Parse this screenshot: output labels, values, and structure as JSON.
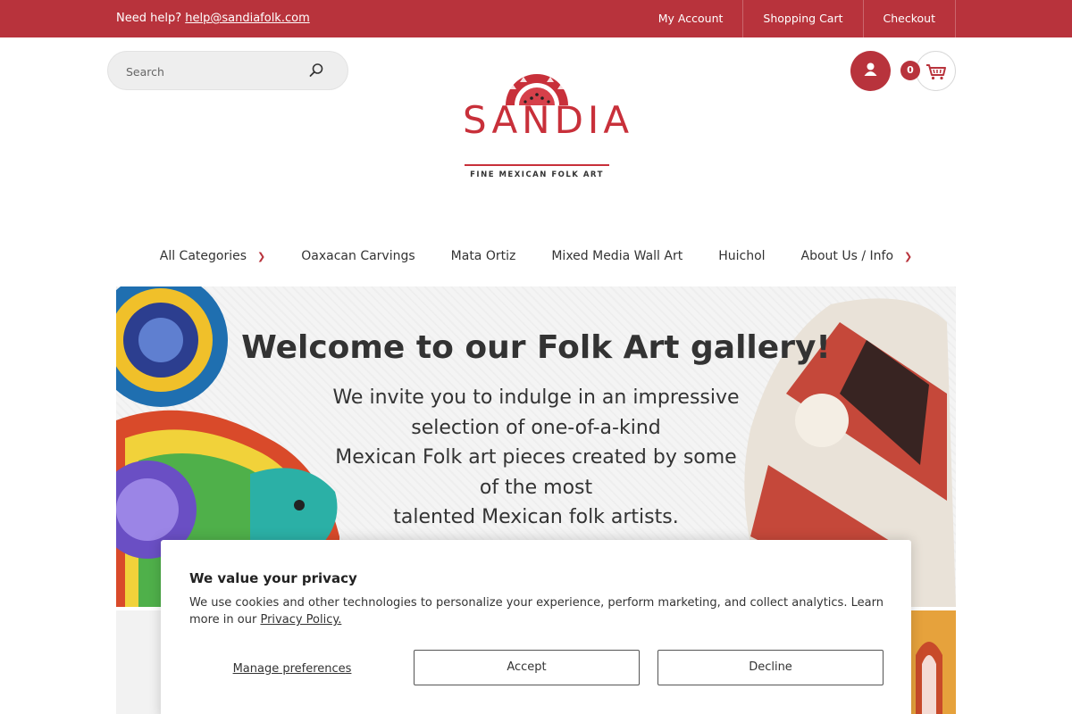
{
  "topbar": {
    "help_prefix": "Need help?",
    "help_email": "help@sandiafolk.com",
    "links": [
      "My Account",
      "Shopping Cart",
      "Checkout"
    ]
  },
  "search": {
    "placeholder": "Search",
    "icon": "search-icon"
  },
  "logo": {
    "word": "SANDIA",
    "tagline": "FINE MEXICAN FOLK ART"
  },
  "header_icons": {
    "account": "user-icon",
    "cart": "cart-icon",
    "cart_count": "0"
  },
  "nav": {
    "items": [
      "All Categories",
      "Oaxacan Carvings",
      "Mata Ortiz",
      "Mixed Media Wall Art",
      "Huichol",
      "About Us / Info"
    ],
    "dropdown_icon": "chevron-down-icon"
  },
  "hero": {
    "title": "Welcome to our Folk Art gallery!",
    "lines": [
      "We invite you to indulge in an impressive",
      "selection of one-of-a-kind",
      "Mexican Folk art pieces created by some",
      "of the most",
      "talented Mexican folk artists."
    ]
  },
  "cookie": {
    "title": "We value your privacy",
    "text": "We use cookies and other technologies to personalize your experience, perform marketing, and collect analytics. Learn more in our",
    "policy_link": "Privacy Policy.",
    "manage": "Manage preferences",
    "accept": "Accept",
    "decline": "Decline"
  },
  "colors": {
    "brand": "#b8333c",
    "text": "#333333"
  }
}
